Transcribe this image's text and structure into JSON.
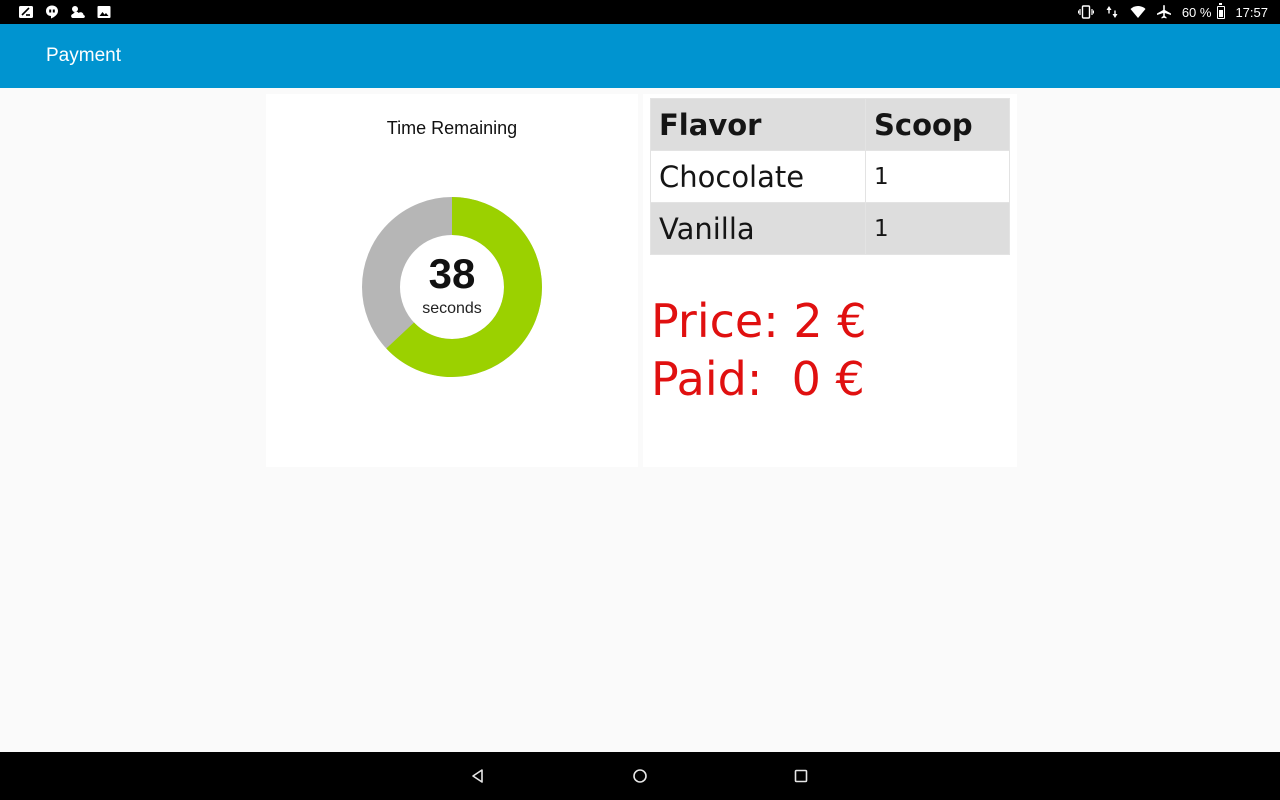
{
  "status_bar": {
    "notification_icons": [
      "screenshot-icon",
      "hangouts-icon",
      "weather-icon",
      "gallery-icon"
    ],
    "system_icons": [
      "vibrate-icon",
      "data-arrows-icon",
      "wifi-icon",
      "airplane-mode-icon"
    ],
    "battery": "60 %",
    "time": "17:57"
  },
  "app_bar": {
    "title": "Payment",
    "color": "#0094d0"
  },
  "timer": {
    "title": "Time Remaining",
    "value": "38",
    "unit": "seconds",
    "remaining_fraction": 0.63,
    "remaining_color": "#9bd100",
    "elapsed_color": "#b6b6b6"
  },
  "order": {
    "headers": {
      "flavor": "Flavor",
      "scoop": "Scoop"
    },
    "rows": [
      {
        "flavor": "Chocolate",
        "scoop": "1"
      },
      {
        "flavor": "Vanilla",
        "scoop": "1"
      }
    ],
    "price_line": "Price: 2 €",
    "paid_line": "Paid:  0 €",
    "money_color": "#e01010"
  },
  "nav_bar": {
    "buttons": [
      "back-icon",
      "home-icon",
      "recents-icon"
    ]
  }
}
